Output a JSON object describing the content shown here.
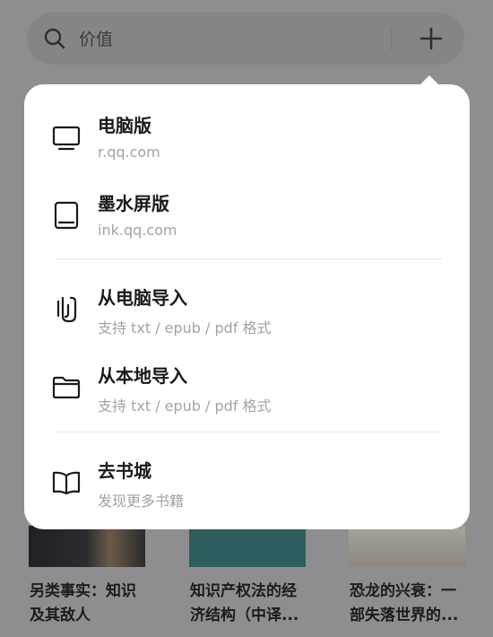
{
  "search": {
    "query": "价值"
  },
  "books": [
    {
      "title_line1": "另类事实：知识",
      "title_line2": "及其敌人"
    },
    {
      "title_line1": "知识产权法的经",
      "title_line2": "济结构（中译..."
    },
    {
      "title_line1": "恐龙的兴衰：一",
      "title_line2": "部失落世界的..."
    }
  ],
  "menu": {
    "items": [
      {
        "icon": "monitor-icon",
        "title": "电脑版",
        "subtitle": "r.qq.com"
      },
      {
        "icon": "tablet-icon",
        "title": "墨水屏版",
        "subtitle": "ink.qq.com"
      },
      {
        "icon": "paperclip-icon",
        "title": "从电脑导入",
        "subtitle": "支持 txt / epub / pdf 格式"
      },
      {
        "icon": "folder-icon",
        "title": "从本地导入",
        "subtitle": "支持 txt / epub / pdf 格式"
      },
      {
        "icon": "open-book-icon",
        "title": "去书城",
        "subtitle": "发现更多书籍"
      }
    ]
  },
  "colors": {
    "backdrop": "#8e8e90",
    "popup": "#ffffff",
    "title_text": "#1a1a1a",
    "subtitle_text": "#a3a3a6"
  }
}
